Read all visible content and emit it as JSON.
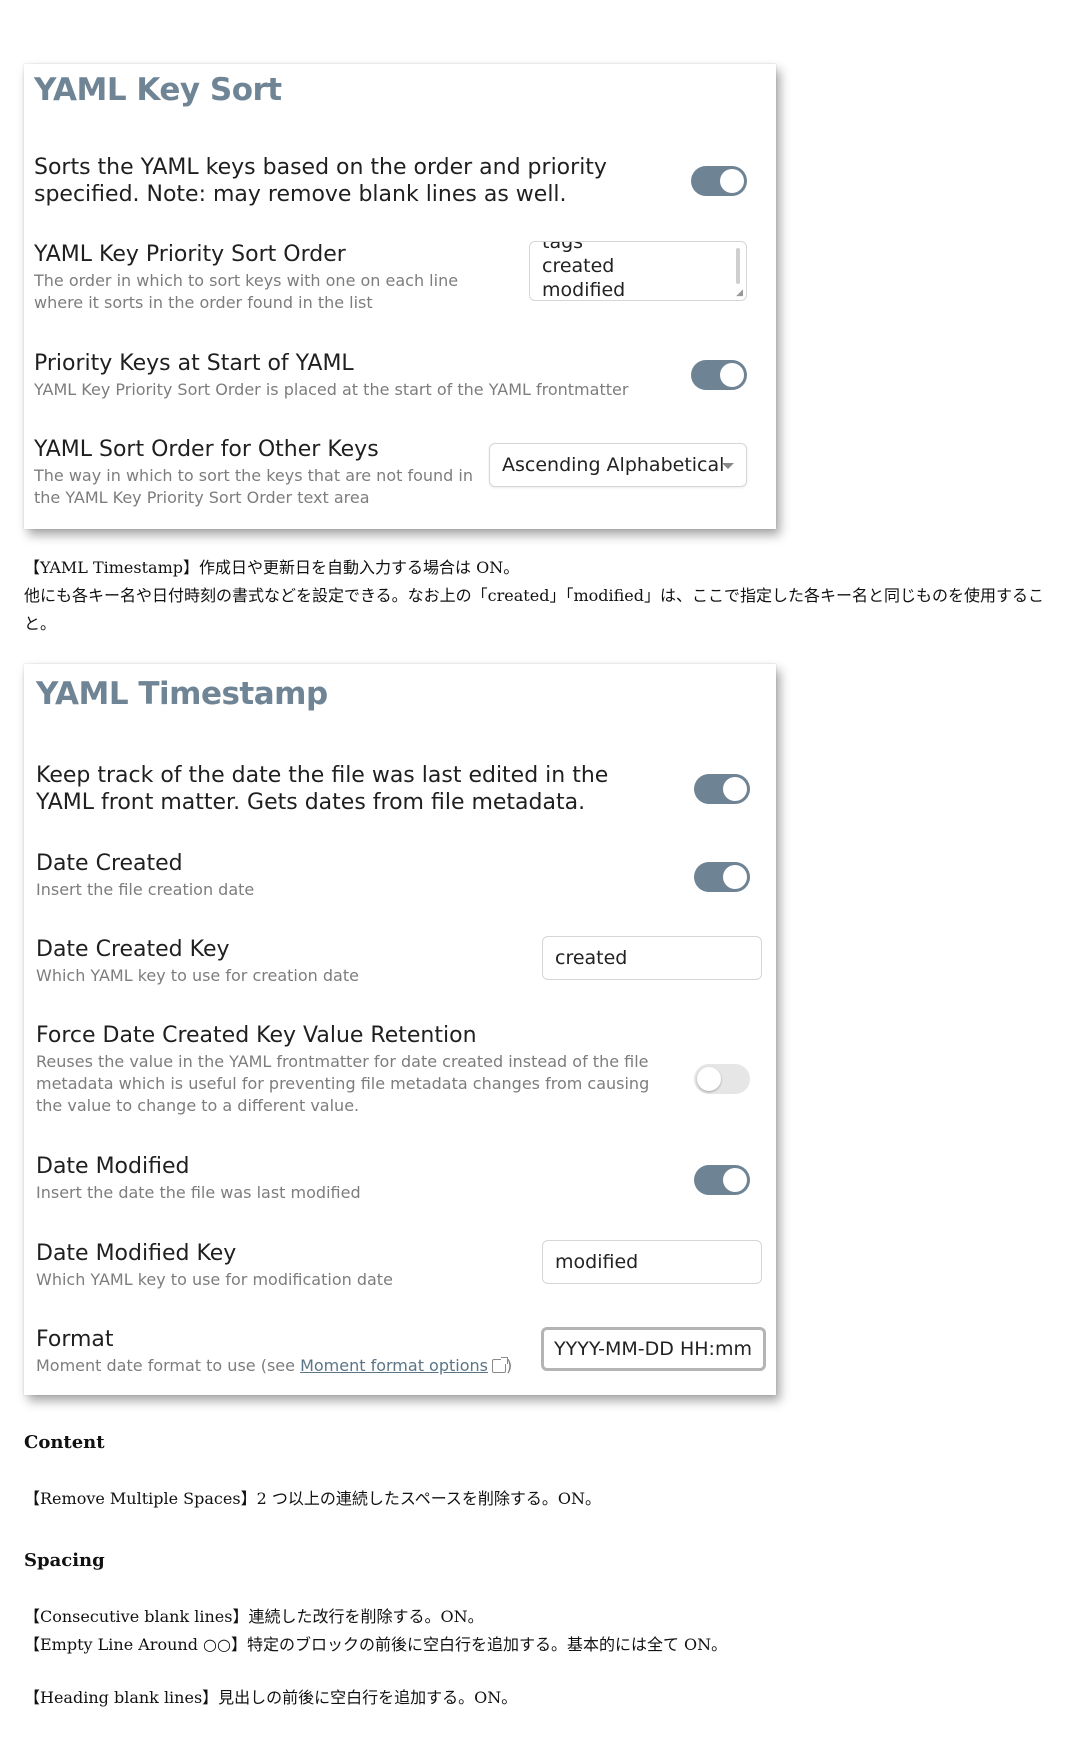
{
  "yaml_key_sort": {
    "title": "YAML Key Sort",
    "settings": [
      {
        "name": "Sorts the YAML keys based on the order and priority specified. Note: may remove blank lines as well.",
        "toggle": "on"
      },
      {
        "name": "YAML Key Priority Sort Order",
        "desc": "The order in which to sort keys with one on each line where it sorts in the order found in the list",
        "textarea_lines": [
          "tags",
          "created",
          "modified"
        ]
      },
      {
        "name": "Priority Keys at Start of YAML",
        "desc": "YAML Key Priority Sort Order is placed at the start of the YAML frontmatter",
        "toggle": "on"
      },
      {
        "name": "YAML Sort Order for Other Keys",
        "desc": "The way in which to sort the keys that are not found in the YAML Key Priority Sort Order text area",
        "select": "Ascending Alphabetical"
      }
    ]
  },
  "para1": {
    "line1": "【YAML Timestamp】作成日や更新日を自動入力する場合は ON。",
    "line2": "他にも各キー名や日付時刻の書式などを設定できる。なお上の「created」「modified」は、ここで指定した各キー名と同じものを使用すること。"
  },
  "yaml_timestamp": {
    "title": "YAML Timestamp",
    "settings": [
      {
        "name": "Keep track of the date the file was last edited in the YAML front matter. Gets dates from file metadata.",
        "toggle": "on"
      },
      {
        "name": "Date Created",
        "desc": "Insert the file creation date",
        "toggle": "on"
      },
      {
        "name": "Date Created Key",
        "desc": "Which YAML key to use for creation date",
        "input": "created"
      },
      {
        "name": "Force Date Created Key Value Retention",
        "desc": "Reuses the value in the YAML frontmatter for date created instead of the file metadata which is useful for preventing file metadata changes from causing the value to change to a different value.",
        "toggle": "off"
      },
      {
        "name": "Date Modified",
        "desc": "Insert the date the file was last modified",
        "toggle": "on"
      },
      {
        "name": "Date Modified Key",
        "desc": "Which YAML key to use for modification date",
        "input": "modified"
      },
      {
        "name": "Format",
        "desc_prefix": "Moment date format to use (see ",
        "link": "Moment format options",
        "desc_suffix": ")",
        "input": "YYYY-MM-DD HH:mm"
      }
    ]
  },
  "content_heading": "Content",
  "content_text": "【Remove Multiple Spaces】2 つ以上の連続したスペースを削除する。ON。",
  "spacing_heading": "Spacing",
  "spacing_text1": "【Consecutive blank lines】連続した改行を削除する。ON。",
  "spacing_text2": "【Empty Line Around ○○】特定のブロックの前後に空白行を追加する。基本的には全て ON。",
  "spacing_text3": "【Heading blank lines】見出しの前後に空白行を追加する。ON。",
  "colors": {
    "toggle_on": "#6e8394",
    "title": "#6f8494",
    "link": "#5b7587"
  }
}
